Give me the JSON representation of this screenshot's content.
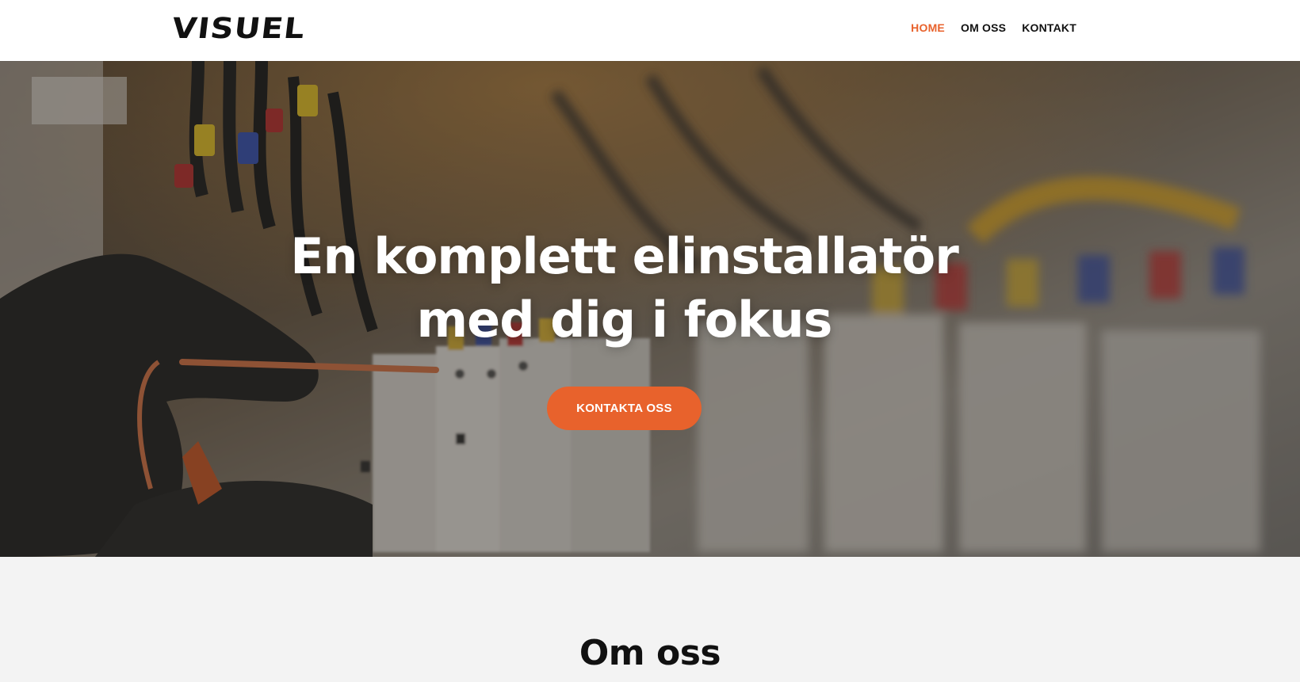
{
  "header": {
    "logo_text": "VISUEL",
    "nav": [
      {
        "label": "HOME",
        "active": true
      },
      {
        "label": "OM OSS",
        "active": false
      },
      {
        "label": "KONTAKT",
        "active": false
      }
    ]
  },
  "hero": {
    "title_line1": "En komplett elinstallatör",
    "title_line2": "med dig i fokus",
    "cta_label": "KONTAKTA OSS"
  },
  "about": {
    "title": "Om oss"
  },
  "colors": {
    "accent": "#e8622c",
    "text_dark": "#111111",
    "section_bg": "#f3f3f3"
  },
  "icons": [
    "logo"
  ]
}
